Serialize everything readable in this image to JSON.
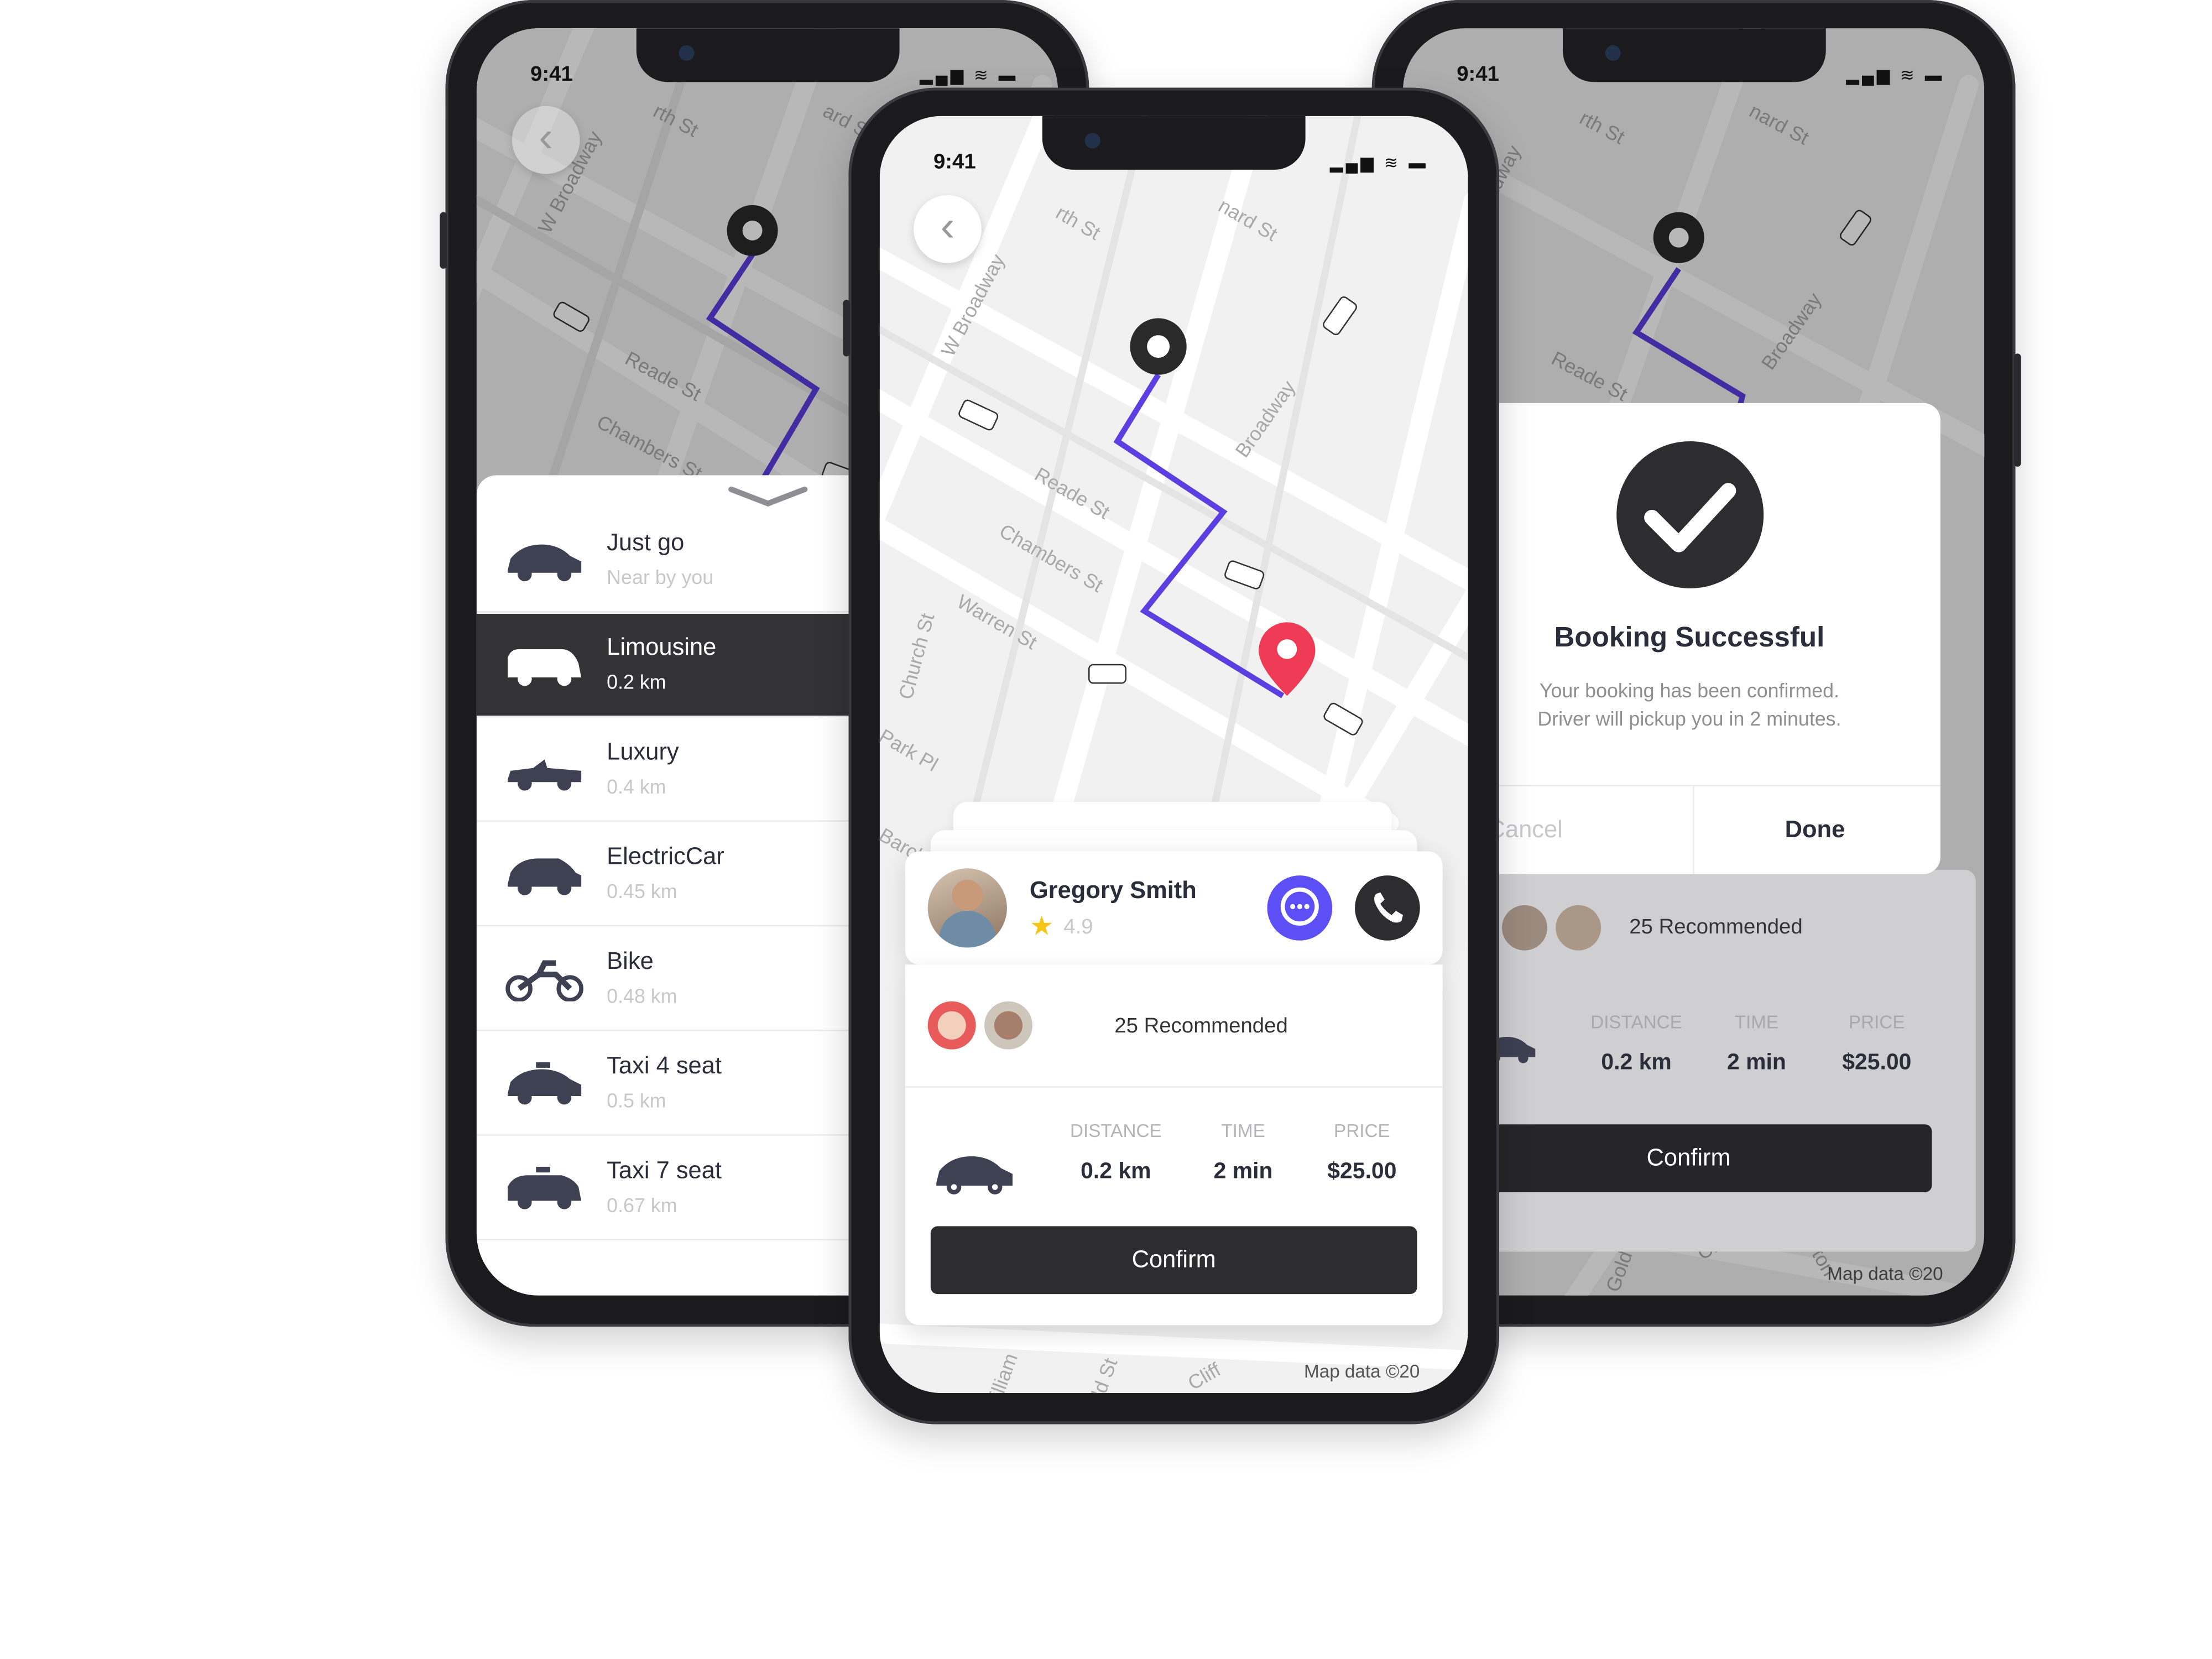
{
  "status": {
    "time": "9:41",
    "indicators": "▂▄▆ ≋ ▬"
  },
  "left_phone": {
    "streets": [
      "W Broadway",
      "Reade St",
      "Chambers St",
      "rth St",
      "ard St"
    ],
    "vehicles": [
      {
        "name": "Just go",
        "sub": "Near by you",
        "icon": "sedan-icon"
      },
      {
        "name": "Limousine",
        "sub": "0.2 km",
        "icon": "van-icon"
      },
      {
        "name": "Luxury",
        "sub": "0.4 km",
        "icon": "convertible-icon"
      },
      {
        "name": "ElectricCar",
        "sub": "0.45 km",
        "icon": "hatchback-icon"
      },
      {
        "name": "Bike",
        "sub": "0.48 km",
        "icon": "motorbike-icon"
      },
      {
        "name": "Taxi  4 seat",
        "sub": "0.5 km",
        "icon": "taxi-icon"
      },
      {
        "name": "Taxi  7 seat",
        "sub": "0.67 km",
        "icon": "taxi-van-icon"
      }
    ],
    "selected_index": 1
  },
  "center_phone": {
    "streets": [
      "W Broadway",
      "Reade St",
      "Chambers St",
      "Warren St",
      "Church St",
      "Park Pl",
      "Broadway",
      "rth St",
      "nard St",
      "Barclay St",
      "William",
      "Gold St",
      "Cliff"
    ],
    "driver": {
      "name": "Gregory Smith",
      "rating": "4.9"
    },
    "recommended": "25 Recommended",
    "stats": {
      "distance_label": "DISTANCE",
      "distance": "0.2 km",
      "time_label": "TIME",
      "time": "2 min",
      "price_label": "PRICE",
      "price": "$25.00"
    },
    "confirm": "Confirm",
    "map_data": "Map data ©20"
  },
  "right_phone": {
    "streets": [
      "W Broadway",
      "Reade St",
      "Broadway",
      "rth St",
      "nard St",
      "Gold St",
      "Cliff",
      "ton"
    ],
    "modal": {
      "title": "Booking Successful",
      "line1": "Your booking has been confirmed.",
      "line2": "Driver will pickup you in 2 minutes.",
      "cancel": "Cancel",
      "done": "Done"
    },
    "recommended": "25 Recommended",
    "stats": {
      "distance_label": "DISTANCE",
      "distance": "0.2 km",
      "time_label": "TIME",
      "time": "2 min",
      "price_label": "PRICE",
      "price": "$25.00"
    },
    "confirm": "Confirm",
    "map_data": "Map data ©20"
  },
  "colors": {
    "route": "#5b3fe0",
    "pin": "#ef3b55",
    "chat": "#5b4ff5",
    "dark": "#2d2d30"
  }
}
